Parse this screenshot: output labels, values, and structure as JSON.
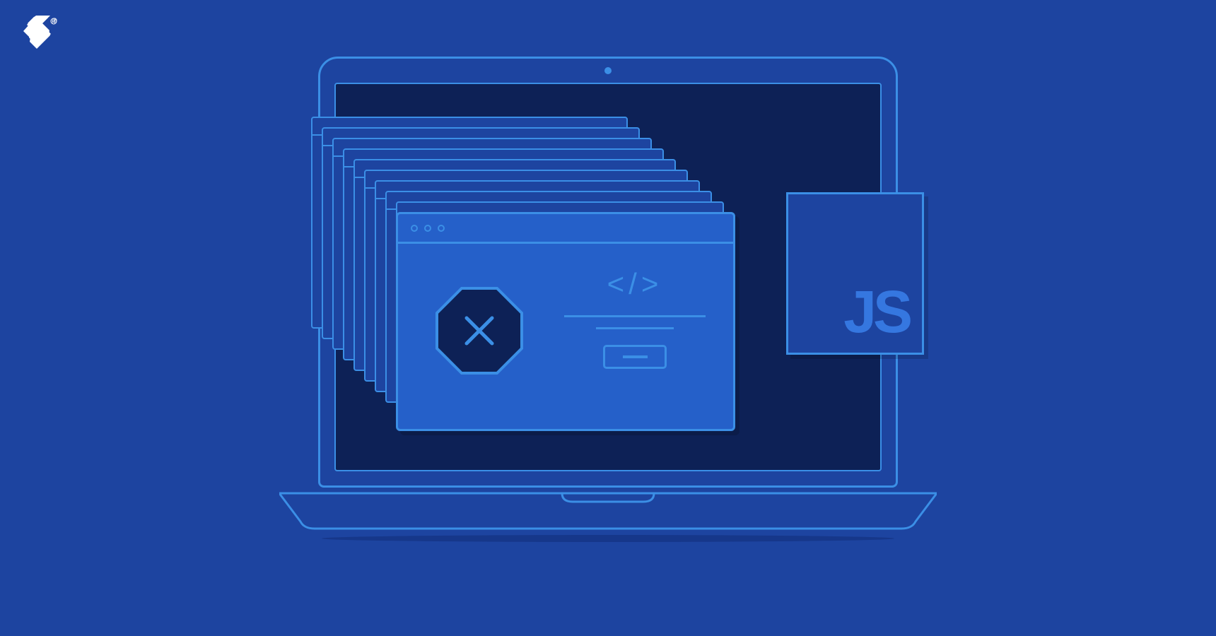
{
  "brand": {
    "name": "Toptal"
  },
  "illustration": {
    "js_badge_text": "JS",
    "code_symbol": "</>",
    "error_symbol": "×",
    "colors": {
      "background": "#1D44A0",
      "stroke": "#3B8FE6",
      "screen_dark": "#0D2156",
      "window_light": "#2560C9",
      "octagon_fill": "#0D2156",
      "js_text": "#3577E0"
    },
    "stacked_window_count": 9
  }
}
